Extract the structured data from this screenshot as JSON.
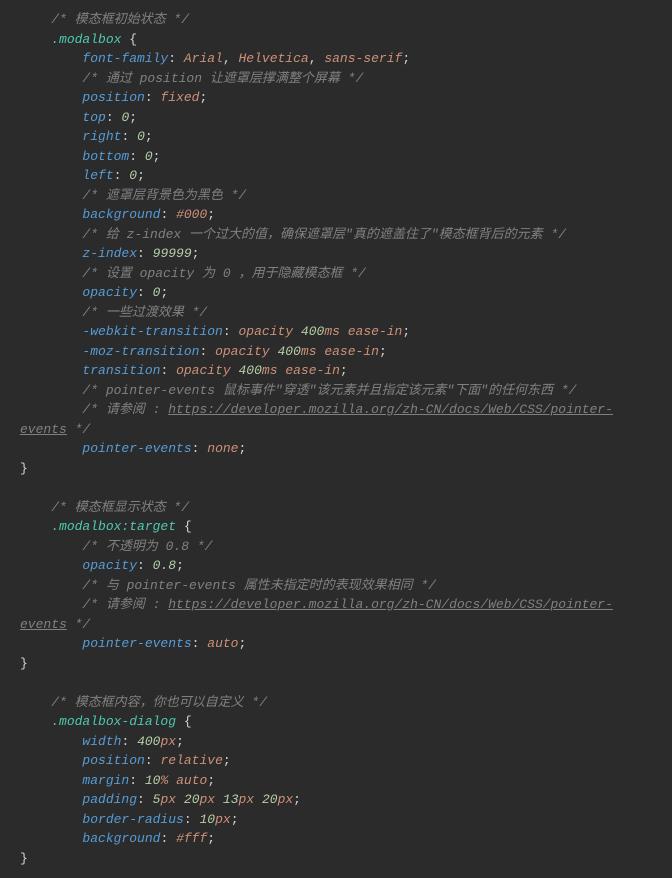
{
  "code": {
    "blocks": [
      {
        "comment": "/* 模态框初始状态 */",
        "selector": ".modalbox",
        "lines": [
          {
            "type": "decl",
            "prop": "font-family",
            "vals": [
              {
                "t": "v",
                "s": "Arial"
              },
              {
                "t": "p",
                "s": ", "
              },
              {
                "t": "v",
                "s": "Helvetica"
              },
              {
                "t": "p",
                "s": ", "
              },
              {
                "t": "v",
                "s": "sans-serif"
              }
            ]
          },
          {
            "type": "cmt",
            "text": "/* 通过 position 让遮罩层撑满整个屏幕 */"
          },
          {
            "type": "decl",
            "prop": "position",
            "vals": [
              {
                "t": "v",
                "s": "fixed"
              }
            ]
          },
          {
            "type": "decl",
            "prop": "top",
            "vals": [
              {
                "t": "n",
                "s": "0"
              }
            ]
          },
          {
            "type": "decl",
            "prop": "right",
            "vals": [
              {
                "t": "n",
                "s": "0"
              }
            ]
          },
          {
            "type": "decl",
            "prop": "bottom",
            "vals": [
              {
                "t": "n",
                "s": "0"
              }
            ]
          },
          {
            "type": "decl",
            "prop": "left",
            "vals": [
              {
                "t": "n",
                "s": "0"
              }
            ]
          },
          {
            "type": "cmt",
            "text": "/* 遮罩层背景色为黑色 */"
          },
          {
            "type": "decl",
            "prop": "background",
            "vals": [
              {
                "t": "v",
                "s": "#000"
              }
            ]
          },
          {
            "type": "cmt",
            "text": "/* 给 z-index 一个过大的值，确保遮罩层\"真的遮盖住了\"模态框背后的元素 */"
          },
          {
            "type": "decl",
            "prop": "z-index",
            "vals": [
              {
                "t": "n",
                "s": "99999"
              }
            ]
          },
          {
            "type": "cmt",
            "text": "/* 设置 opacity 为 0 ，用于隐藏模态框 */"
          },
          {
            "type": "decl",
            "prop": "opacity",
            "vals": [
              {
                "t": "n",
                "s": "0"
              }
            ]
          },
          {
            "type": "cmt",
            "text": "/* 一些过渡效果 */"
          },
          {
            "type": "decl",
            "prop": "-webkit-transition",
            "vals": [
              {
                "t": "v",
                "s": "opacity"
              },
              {
                "t": "sp"
              },
              {
                "t": "n",
                "s": "400"
              },
              {
                "t": "u",
                "s": "ms"
              },
              {
                "t": "sp"
              },
              {
                "t": "v",
                "s": "ease-in"
              }
            ]
          },
          {
            "type": "decl",
            "prop": "-moz-transition",
            "vals": [
              {
                "t": "v",
                "s": "opacity"
              },
              {
                "t": "sp"
              },
              {
                "t": "n",
                "s": "400"
              },
              {
                "t": "u",
                "s": "ms"
              },
              {
                "t": "sp"
              },
              {
                "t": "v",
                "s": "ease-in"
              }
            ]
          },
          {
            "type": "decl",
            "prop": "transition",
            "vals": [
              {
                "t": "v",
                "s": "opacity"
              },
              {
                "t": "sp"
              },
              {
                "t": "n",
                "s": "400"
              },
              {
                "t": "u",
                "s": "ms"
              },
              {
                "t": "sp"
              },
              {
                "t": "v",
                "s": "ease-in"
              }
            ]
          },
          {
            "type": "cmt",
            "text": "/* pointer-events 鼠标事件\"穿透\"该元素并且指定该元素\"下面\"的任何东西 */"
          },
          {
            "type": "cmtlink",
            "pre": "/* 请参阅 : ",
            "link": "https://developer.mozilla.org/zh-CN/docs/Web/CSS/pointer-events",
            "post": " */"
          },
          {
            "type": "decl",
            "prop": "pointer-events",
            "vals": [
              {
                "t": "v",
                "s": "none"
              }
            ]
          }
        ]
      },
      {
        "comment": "/* 模态框显示状态 */",
        "selector": ".modalbox:target",
        "lines": [
          {
            "type": "cmt",
            "text": "/* 不透明为 0.8 */"
          },
          {
            "type": "decl",
            "prop": "opacity",
            "vals": [
              {
                "t": "n",
                "s": "0.8"
              }
            ]
          },
          {
            "type": "cmt",
            "text": "/* 与 pointer-events 属性未指定时的表现效果相同 */"
          },
          {
            "type": "cmtlink",
            "pre": "/* 请参阅 : ",
            "link": "https://developer.mozilla.org/zh-CN/docs/Web/CSS/pointer-events",
            "post": " */"
          },
          {
            "type": "decl",
            "prop": "pointer-events",
            "vals": [
              {
                "t": "v",
                "s": "auto"
              }
            ]
          }
        ]
      },
      {
        "comment": "/* 模态框内容，你也可以自定义 */",
        "selector": ".modalbox-dialog",
        "lines": [
          {
            "type": "decl",
            "prop": "width",
            "vals": [
              {
                "t": "n",
                "s": "400"
              },
              {
                "t": "u",
                "s": "px"
              }
            ]
          },
          {
            "type": "decl",
            "prop": "position",
            "vals": [
              {
                "t": "v",
                "s": "relative"
              }
            ]
          },
          {
            "type": "decl",
            "prop": "margin",
            "vals": [
              {
                "t": "n",
                "s": "10"
              },
              {
                "t": "u",
                "s": "%"
              },
              {
                "t": "sp"
              },
              {
                "t": "v",
                "s": "auto"
              }
            ]
          },
          {
            "type": "decl",
            "prop": "padding",
            "vals": [
              {
                "t": "n",
                "s": "5"
              },
              {
                "t": "u",
                "s": "px"
              },
              {
                "t": "sp"
              },
              {
                "t": "n",
                "s": "20"
              },
              {
                "t": "u",
                "s": "px"
              },
              {
                "t": "sp"
              },
              {
                "t": "n",
                "s": "13"
              },
              {
                "t": "u",
                "s": "px"
              },
              {
                "t": "sp"
              },
              {
                "t": "n",
                "s": "20"
              },
              {
                "t": "u",
                "s": "px"
              }
            ]
          },
          {
            "type": "decl",
            "prop": "border-radius",
            "vals": [
              {
                "t": "n",
                "s": "10"
              },
              {
                "t": "u",
                "s": "px"
              }
            ]
          },
          {
            "type": "decl",
            "prop": "background",
            "vals": [
              {
                "t": "v",
                "s": "#fff"
              }
            ]
          }
        ]
      }
    ]
  }
}
